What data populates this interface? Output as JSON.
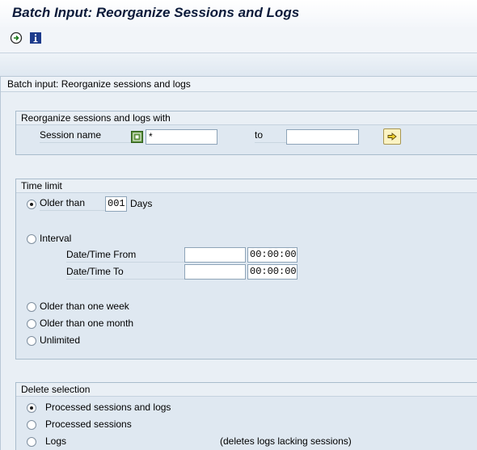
{
  "window": {
    "title": "Batch Input: Reorganize Sessions and Logs"
  },
  "toolbar": {
    "execute_icon": "execute-clock-icon",
    "info_icon": "info-icon"
  },
  "panel": {
    "title": "Batch input: Reorganize sessions and logs"
  },
  "reorganize": {
    "title": "Reorganize sessions and logs with",
    "session_label": "Session name",
    "session_value": "*",
    "to_label": "to",
    "to_value": "",
    "multiple_selection_icon": "arrow-right-icon"
  },
  "time_limit": {
    "title": "Time limit",
    "older_than_label": "Older than",
    "older_than_days": "001",
    "days_label": "Days",
    "interval_label": "Interval",
    "from_label": "Date/Time From",
    "from_date": "",
    "from_time": "00:00:00",
    "to_label": "Date/Time To",
    "to_date": "",
    "to_time": "00:00:00",
    "one_week_label": "Older than one week",
    "one_month_label": "Older than one month",
    "unlimited_label": "Unlimited",
    "selected": "older_than"
  },
  "delete_selection": {
    "title": "Delete selection",
    "processed_both_label": "Processed sessions and logs",
    "processed_sessions_label": "Processed sessions",
    "logs_label": "Logs",
    "logs_note": "(deletes logs lacking sessions)",
    "selected": "processed_both"
  }
}
